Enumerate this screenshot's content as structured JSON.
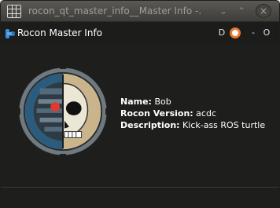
{
  "window": {
    "title": "rocon_qt_master_info__Master Info -...",
    "minimize_glyph": "⌄",
    "maximize_glyph": "⌃",
    "close_glyph": "×"
  },
  "plugin": {
    "title": "Rocon Master Info",
    "reload_glyph": "D",
    "minimize_glyph": "-",
    "close_glyph": "O"
  },
  "info": {
    "name_label": "Name:",
    "name_value": "Bob",
    "version_label": "Rocon Version:",
    "version_value": "acdc",
    "description_label": "Description:",
    "description_value": "Kick-ass ROS turtle"
  },
  "icons": {
    "app": "grid-icon",
    "plugin": "ros-plugin-icon",
    "help": "help-ring-icon",
    "logo": "turtle-skull-gear-logo"
  },
  "colors": {
    "accent_orange": "#e8772e",
    "plugin_icon_blue": "#3a8fd8"
  }
}
